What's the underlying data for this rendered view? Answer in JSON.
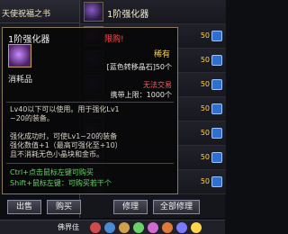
{
  "shop_rows": [
    {
      "label": "天使祝福之书"
    }
  ],
  "right_rows": [
    {
      "name": "1阶强化器",
      "price": "50"
    },
    {
      "name": "",
      "price": "50"
    },
    {
      "name": "",
      "price": "50"
    },
    {
      "name": "",
      "price": "50"
    },
    {
      "name": "",
      "price": "50"
    },
    {
      "name": "",
      "price": "50"
    },
    {
      "name": "",
      "price": "50"
    },
    {
      "name": "",
      "price": "50"
    }
  ],
  "tooltip": {
    "title": "1阶强化器",
    "top_tag": "限购!",
    "rarity": "稀有",
    "category": "消耗品",
    "material": "[蓝色转移晶石]50个",
    "tradable": "无法交易",
    "limit": "携带上限：1000个",
    "desc_lines": [
      "Lv40以下可以使用。用于强化Lv1",
      "~20的装备。",
      "",
      "强化成功时，可使Lv1~20的装备",
      "强化数值+1（最高可强化至+10）",
      "且不消耗无色小晶块和金币。"
    ],
    "hint_lines": [
      "Ctrl+点击鼠标左键可购买",
      "Shift+鼠标左键：可购买若干个"
    ]
  },
  "buttons": {
    "sell": "出售",
    "buy": "购买",
    "repair": "修理",
    "repair_all": "全部修理"
  },
  "taskbar": {
    "label": "佛界佳"
  },
  "colors": {
    "rare": "#f5d35a",
    "untradable": "#ff5a5a",
    "hint": "#6ad06a",
    "price": "#ffd34a"
  }
}
